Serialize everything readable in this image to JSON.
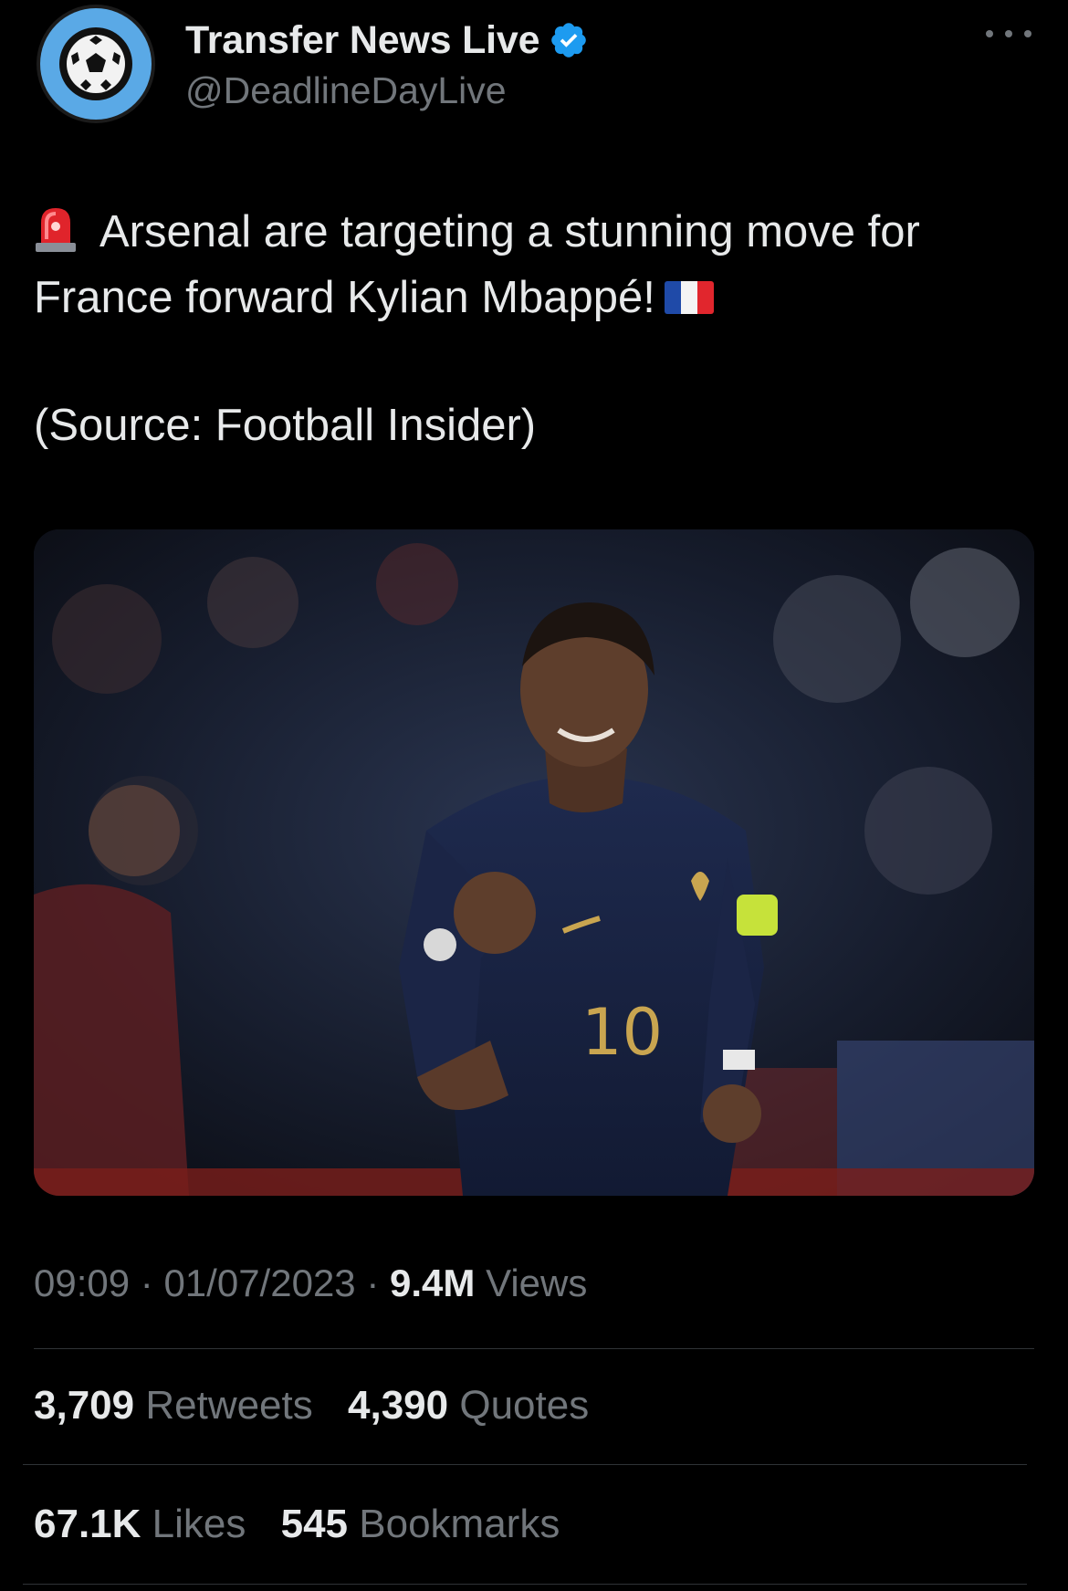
{
  "account": {
    "display_name": "Transfer News Live",
    "handle": "@DeadlineDayLive",
    "avatar_icon": "soccer-ball-icon",
    "verified_icon": "verified-badge-icon",
    "verified_color": "#1d9bf0"
  },
  "more_icon": "more-options-icon",
  "tweet": {
    "siren_icon": "police-light-emoji",
    "line1": "Arsenal are targeting a stunning move for France forward Kylian Mbappé!",
    "flag_icon": "france-flag-emoji",
    "source": "(Source: Football Insider)"
  },
  "media": {
    "description_icon": "photo-player-celebrating"
  },
  "meta": {
    "time": "09:09",
    "separator": "·",
    "date": "01/07/2023",
    "views_count": "9.4M",
    "views_label": "Views"
  },
  "stats": {
    "retweets_count": "3,709",
    "retweets_label": "Retweets",
    "quotes_count": "4,390",
    "quotes_label": "Quotes",
    "likes_count": "67.1K",
    "likes_label": "Likes",
    "bookmarks_count": "545",
    "bookmarks_label": "Bookmarks"
  },
  "colors": {
    "background": "#000000",
    "primary_text": "#e7e9ea",
    "secondary_text": "#71767b",
    "divider": "#2f3336",
    "avatar_blue": "#5aa9e6"
  }
}
